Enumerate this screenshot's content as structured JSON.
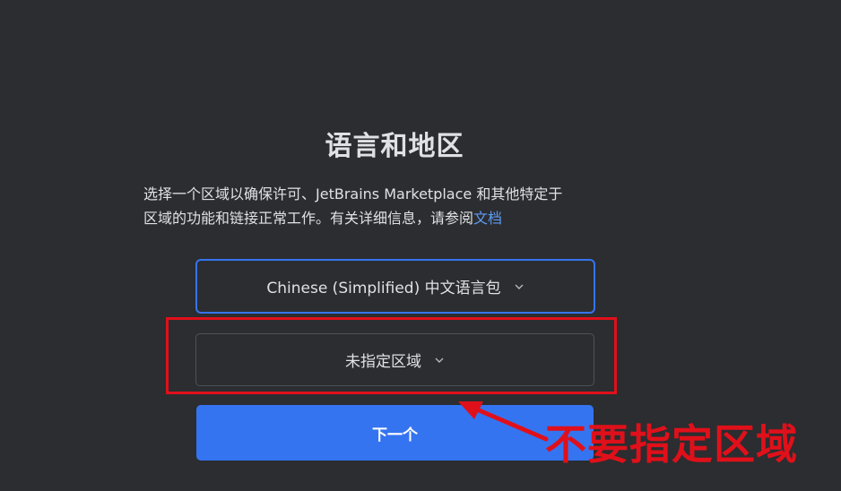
{
  "dialog": {
    "title": "语言和地区",
    "description_line1": "选择一个区域以确保许可、JetBrains Marketplace 和其他特定于",
    "description_line2": "区域的功能和链接正常工作。有关详细信息，请参阅",
    "docs_link": "文档"
  },
  "language_select": {
    "value": "Chinese (Simplified) 中文语言包"
  },
  "region_select": {
    "value": "未指定区域"
  },
  "next_button": {
    "label": "下一个"
  },
  "annotation": {
    "text": "不要指定区域",
    "color": "#e0101a"
  },
  "colors": {
    "background": "#2b2d30",
    "accent": "#3574f0",
    "link": "#5f9bf5"
  }
}
